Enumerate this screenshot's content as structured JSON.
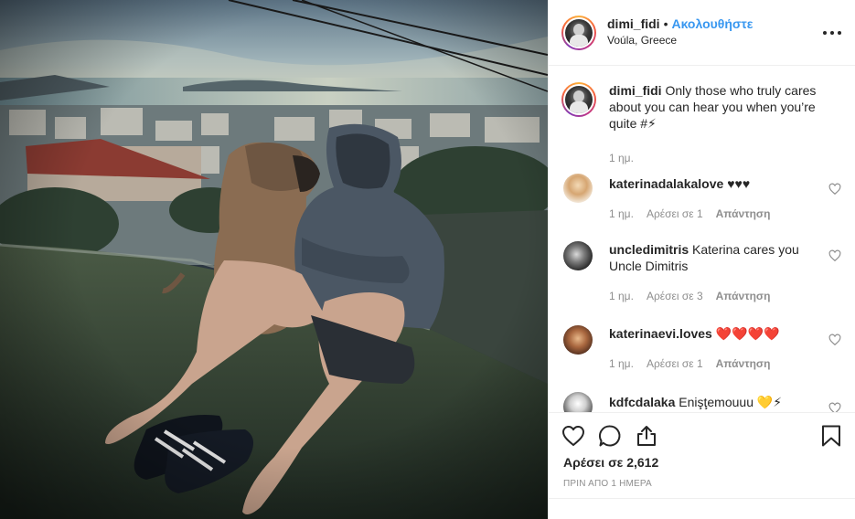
{
  "post": {
    "username": "dimi_fidi",
    "separator": "•",
    "follow_label": "Ακολουθήστε",
    "location": "Voúla, Greece",
    "more_icon": "more-options-icon"
  },
  "caption": {
    "username": "dimi_fidi",
    "text": "Only those who truly cares about you can hear you when you’re quite #⚡",
    "time": "1 ημ."
  },
  "comments": [
    {
      "username": "katerinadalakalove",
      "text": "♥♥♥",
      "time": "1 ημ.",
      "likes": "Αρέσει σε 1",
      "reply": "Απάντηση"
    },
    {
      "username": "uncledimitris",
      "text": "Katerina cares you Uncle Dimitris",
      "time": "1 ημ.",
      "likes": "Αρέσει σε 3",
      "reply": "Απάντηση"
    },
    {
      "username": "katerinaevi.loves",
      "text": "❤️❤️❤️❤️",
      "time": "1 ημ.",
      "likes": "Αρέσει σε 1",
      "reply": "Απάντηση"
    },
    {
      "username": "kdfcdalaka",
      "text": "Enişţemouuu 💛⚡"
    }
  ],
  "actions": {
    "likes_label": "Αρέσει σε 2,612",
    "timestamp": "ΠΡΙΝ ΑΠΟ 1 ΗΜΕΡΑ"
  },
  "colors": {
    "accent": "#3897f0",
    "text": "#262626",
    "muted": "#8e8e8e",
    "border": "#efefef"
  }
}
